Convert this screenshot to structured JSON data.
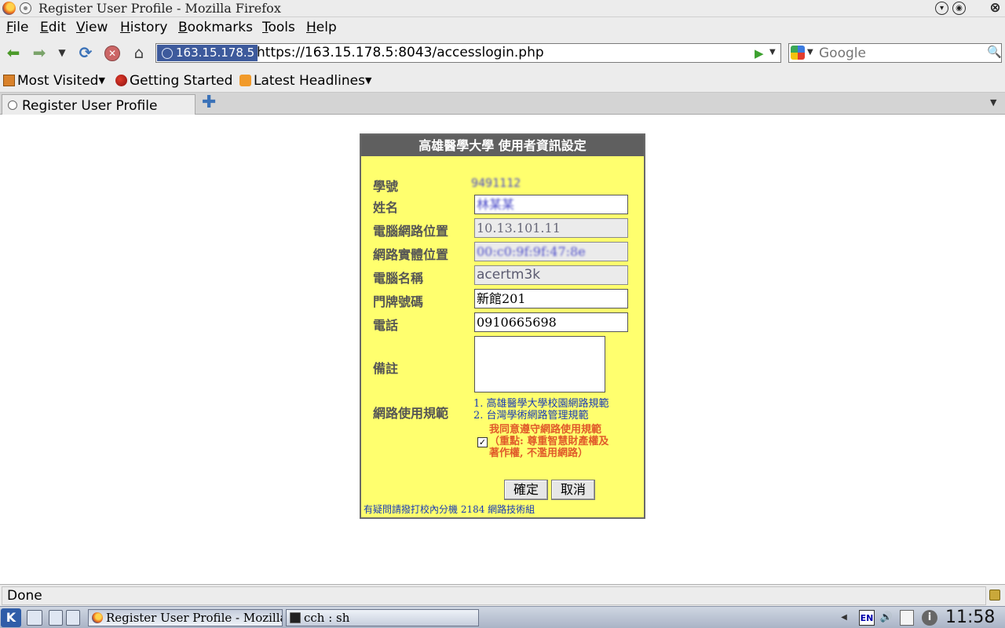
{
  "window": {
    "title": "Register User Profile - Mozilla Firefox"
  },
  "menu": [
    "File",
    "Edit",
    "View",
    "History",
    "Bookmarks",
    "Tools",
    "Help"
  ],
  "nav": {
    "site_identity": "163.15.178.5",
    "url": "https://163.15.178.5:8043/accesslogin.php",
    "search_placeholder": "Google"
  },
  "bookmarks": {
    "most_visited": "Most Visited",
    "getting_started": "Getting Started",
    "latest_headlines": "Latest Headlines"
  },
  "tabs": [
    {
      "label": "Register User Profile"
    }
  ],
  "form": {
    "header": "高雄醫學大學 使用者資訊設定",
    "labels": {
      "student_id": "學號",
      "name": "姓名",
      "ip": "電腦網路位置",
      "mac": "網路實體位置",
      "computer_name": "電腦名稱",
      "room": "門牌號碼",
      "phone": "電話",
      "remark": "備註",
      "rules": "網路使用規範"
    },
    "values": {
      "student_id": "9491112",
      "name": "林某某",
      "ip": "10.13.101.11",
      "mac": "00:c0:9f:9f:47:8e",
      "computer_name": "acertm3k",
      "room": "新館201",
      "phone": "0910665698",
      "remark": ""
    },
    "rules_links": [
      "1. 高雄醫學大學校園網路規範",
      "2. 台灣學術網路管理規範"
    ],
    "agree_text": [
      "我同意遵守網路使用規範",
      "（重點: 尊重智慧財產權及",
      "著作權, 不濫用網路）"
    ],
    "agree_checked": true,
    "buttons": {
      "ok": "確定",
      "cancel": "取消"
    },
    "help": "有疑問請撥打校內分機 2184 網路技術組"
  },
  "status": {
    "text": "Done"
  },
  "taskbar": {
    "tasks": [
      "Register User Profile - Mozilla Firefox",
      "cch : sh"
    ],
    "lang": "EN",
    "clock": "11:58"
  }
}
